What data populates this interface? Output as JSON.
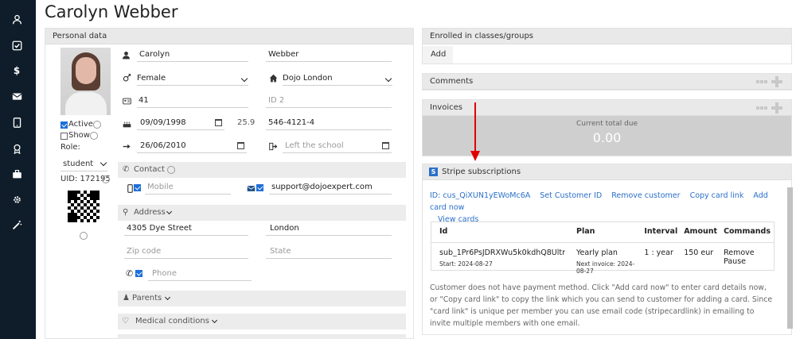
{
  "page": {
    "title": "Carolyn Webber"
  },
  "sidebar": {
    "icons": [
      "user-icon",
      "checkbox-icon",
      "dollar-icon",
      "envelope-icon",
      "tablet-icon",
      "award-icon",
      "briefcase-icon",
      "gear-icon",
      "magic-wand-icon"
    ]
  },
  "personal": {
    "header": "Personal data",
    "first_name": "Carolyn",
    "last_name": "Webber",
    "gender": "Female",
    "school": "Dojo London",
    "number": "41",
    "id_placeholder": "ID 2",
    "birthdate": "09/09/1998",
    "age": "25.9",
    "phone_code": "546-4121-4",
    "join_date": "26/06/2010",
    "left_placeholder": "Left the school",
    "active_label": "Active",
    "show_label": "Show",
    "role_label": "Role:",
    "role_value": "student",
    "uid": "UID: 172195",
    "contact_label": "Contact",
    "mobile_placeholder": "Mobile",
    "email": "support@dojoexpert.com",
    "address_label": "Address",
    "street": "4305 Dye Street",
    "city": "London",
    "zip_placeholder": "Zip code",
    "state_placeholder": "State",
    "phone_placeholder": "Phone",
    "parents_label": "Parents",
    "medical_label": "Medical conditions"
  },
  "enrolled": {
    "header": "Enrolled in classes/groups",
    "add_label": "Add"
  },
  "comments": {
    "header": "Comments"
  },
  "invoices": {
    "header": "Invoices",
    "total_label": "Current total due",
    "total_value": "0.00"
  },
  "stripe": {
    "header": "Stripe subscriptions",
    "badge": "S",
    "links": [
      "ID: cus_QiXUN1yEWoMc6A",
      "Set Customer ID",
      "Remove customer",
      "Copy card link",
      "Add card now",
      "View cards"
    ],
    "columns": [
      "Id",
      "Plan",
      "Interval",
      "Amount",
      "Commands"
    ],
    "row": {
      "id": "sub_1Pr6PsJDRXWu5k0kdhQ8Ultr",
      "start": "Start: 2024-08-27",
      "plan": "Yearly plan",
      "next": "Next invoice: 2024-08-27",
      "interval": "1 : year",
      "amount": "150 eur",
      "command": "Remove Pause"
    },
    "note": "Customer does not have payment method. Click \"Add card now\" to enter card details now, or \"Copy card link\" to copy the link which you can send to customer for adding a card. Since \"card link\" is unique per member you can use email code (stripecardlink) in emailing to invite multiple members with one email."
  },
  "colors": {
    "sidebar": "#0f1d2a",
    "link": "#2a6fc9",
    "arrow": "#e00000",
    "checkbox": "#1e6fd9"
  }
}
